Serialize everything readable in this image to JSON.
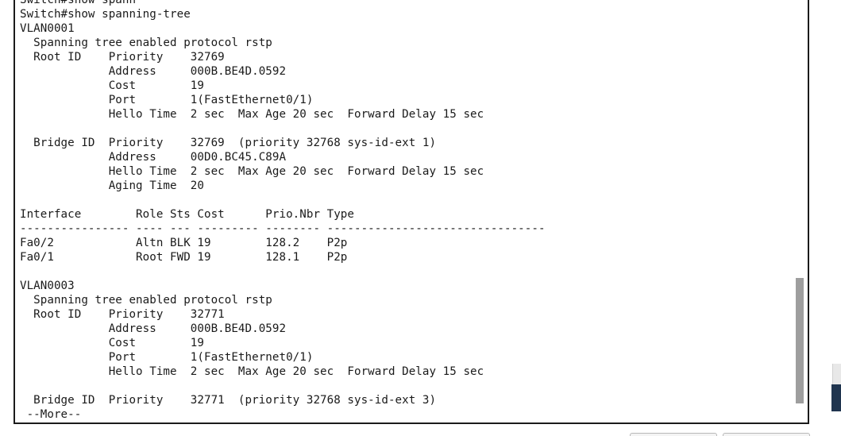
{
  "terminal": {
    "lines": [
      "Switch#show spann",
      "Switch#show spanning-tree",
      "VLAN0001",
      "  Spanning tree enabled protocol rstp",
      "  Root ID    Priority    32769",
      "             Address     000B.BE4D.0592",
      "             Cost        19",
      "             Port        1(FastEthernet0/1)",
      "             Hello Time  2 sec  Max Age 20 sec  Forward Delay 15 sec",
      "",
      "  Bridge ID  Priority    32769  (priority 32768 sys-id-ext 1)",
      "             Address     00D0.BC45.C89A",
      "             Hello Time  2 sec  Max Age 20 sec  Forward Delay 15 sec",
      "             Aging Time  20",
      "",
      "Interface        Role Sts Cost      Prio.Nbr Type",
      "---------------- ---- --- --------- -------- --------------------------------",
      "Fa0/2            Altn BLK 19        128.2    P2p",
      "Fa0/1            Root FWD 19        128.1    P2p",
      "",
      "VLAN0003",
      "  Spanning tree enabled protocol rstp",
      "  Root ID    Priority    32771",
      "             Address     000B.BE4D.0592",
      "             Cost        19",
      "             Port        1(FastEthernet0/1)",
      "             Hello Time  2 sec  Max Age 20 sec  Forward Delay 15 sec",
      "",
      "  Bridge ID  Priority    32771  (priority 32768 sys-id-ext 3)",
      " --More--"
    ]
  }
}
